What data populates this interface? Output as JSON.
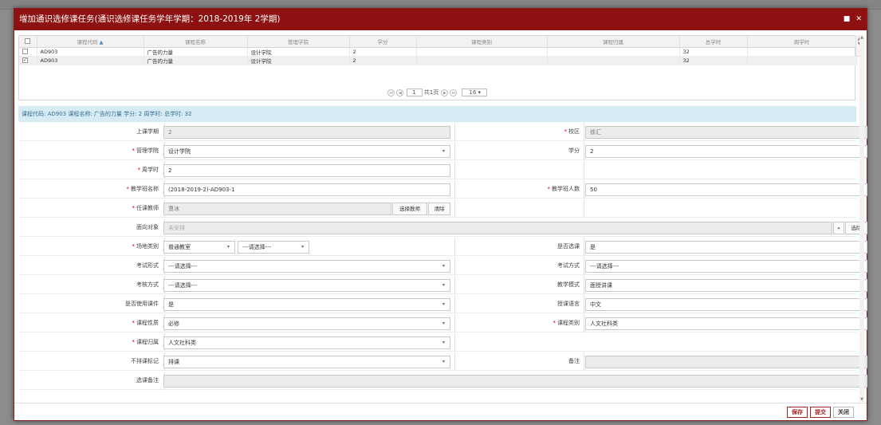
{
  "dialog": {
    "title": "增加通识选修课任务(通识选修课任务学年学期：2018-2019年 2学期)",
    "ctrl_max": "■",
    "ctrl_close": "✕"
  },
  "grid": {
    "sort_icon": "▲",
    "headers": [
      "课程代码",
      "课程名称",
      "管理学院",
      "学分",
      "课程类别",
      "课程归属",
      "总学时",
      "周学时"
    ],
    "rows": [
      {
        "checked": false,
        "check_mark": "",
        "code": "AD903",
        "name": "广告的力量",
        "college": "设计学院",
        "credit": "2",
        "type": "",
        "belong": "",
        "total": "32",
        "week": ""
      },
      {
        "checked": true,
        "check_mark": "✓",
        "code": "AD903",
        "name": "广告的力量",
        "college": "设计学院",
        "credit": "2",
        "type": "",
        "belong": "",
        "total": "32",
        "week": ""
      }
    ],
    "pager": {
      "first": "⏮",
      "prev": "◀",
      "current": "1",
      "total_label": "共1页",
      "next": "▶",
      "last": "⏭",
      "page_size": "16",
      "caret": "▾"
    }
  },
  "info": "课程代码: AD903  课程名称: 广告的力量  学分: 2  周学时:   总学时: 32",
  "form": {
    "term_label": "上课学期",
    "term_value": "2",
    "campus_label": "校区",
    "campus_value": "徐汇",
    "college_label": "管理学院",
    "college_value": "设计学院",
    "credit_label": "学分",
    "credit_value": "2",
    "week_hours_label": "周学时",
    "week_hours_value": "2",
    "class_name_label": "教学班名称",
    "class_name_value": "(2018-2019-2)-AD903-1",
    "class_size_label": "教学班人数",
    "class_size_value": "50",
    "teacher_label": "任课教师",
    "teacher_value": "萧冰",
    "select_teacher_btn": "选择教师",
    "clear_btn": "清除",
    "target_label": "面向对象",
    "target_placeholder": "未安排",
    "target_more": "»",
    "target_select_btn": "选除",
    "venue_label": "场地类别",
    "venue_value": "普通教室",
    "venue_sub": "---请选择---",
    "elective_label": "是否选课",
    "elective_value": "是",
    "exam_form_label": "考试形式",
    "exam_form_value": "---请选择---",
    "exam_method_label": "考试方式",
    "exam_method_value": "---请选择---",
    "assess_label": "考核方式",
    "assess_value": "---请选择---",
    "teaching_mode_label": "教学模式",
    "teaching_mode_value": "面授讲课",
    "courseware_label": "是否使用课件",
    "courseware_value": "是",
    "language_label": "授课语言",
    "language_value": "中文",
    "nature_label": "课程性质",
    "nature_value": "必修",
    "category_label": "课程类别",
    "category_value": "人文社科类",
    "attribution_label": "课程归属",
    "attribution_value": "人文社科类",
    "no_schedule_label": "不排课标记",
    "no_schedule_value": "排课",
    "remark_label": "备注",
    "remark_value": "",
    "elective_remark_label": "选课备注",
    "elective_remark_value": "",
    "required_mark": "*",
    "caret": "▾"
  },
  "footer": {
    "save": "保存",
    "submit": "提交",
    "close": "关闭"
  },
  "scroll": {
    "up": "▲",
    "down": "▼"
  }
}
